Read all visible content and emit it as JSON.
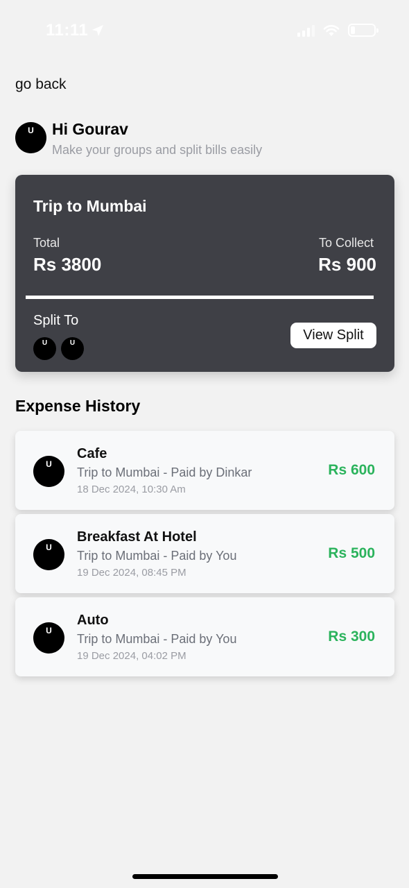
{
  "status_bar": {
    "time": "11:11"
  },
  "nav": {
    "back_label": "go back"
  },
  "greeting": {
    "avatar_letter": "U",
    "title": "Hi Gourav",
    "subtitle": "Make your groups and split bills easily"
  },
  "group": {
    "title": "Trip to Mumbai",
    "total_label": "Total",
    "total_value": "Rs 3800",
    "collect_label": "To Collect",
    "collect_value": "Rs 900",
    "split_label": "Split To",
    "split_avatars": [
      "U",
      "U"
    ],
    "view_split_label": "View Split"
  },
  "history": {
    "title": "Expense History",
    "items": [
      {
        "avatar": "U",
        "title": "Cafe",
        "subtitle": "Trip to Mumbai - Paid by Dinkar",
        "date": "18 Dec 2024, 10:30 Am",
        "amount": "Rs 600"
      },
      {
        "avatar": "U",
        "title": "Breakfast At Hotel",
        "subtitle": "Trip to Mumbai - Paid by You",
        "date": "19 Dec 2024, 08:45 PM",
        "amount": "Rs 500"
      },
      {
        "avatar": "U",
        "title": "Auto",
        "subtitle": "Trip to Mumbai - Paid by You",
        "date": "19 Dec 2024, 04:02 PM",
        "amount": "Rs 300"
      }
    ]
  },
  "colors": {
    "background": "#f2f2f2",
    "card_dark": "#3f4046",
    "amount_green": "#2bb35c",
    "muted_text": "#9a9ca3"
  },
  "icons": [
    "location-arrow-icon",
    "signal-icon",
    "wifi-icon",
    "battery-icon"
  ]
}
